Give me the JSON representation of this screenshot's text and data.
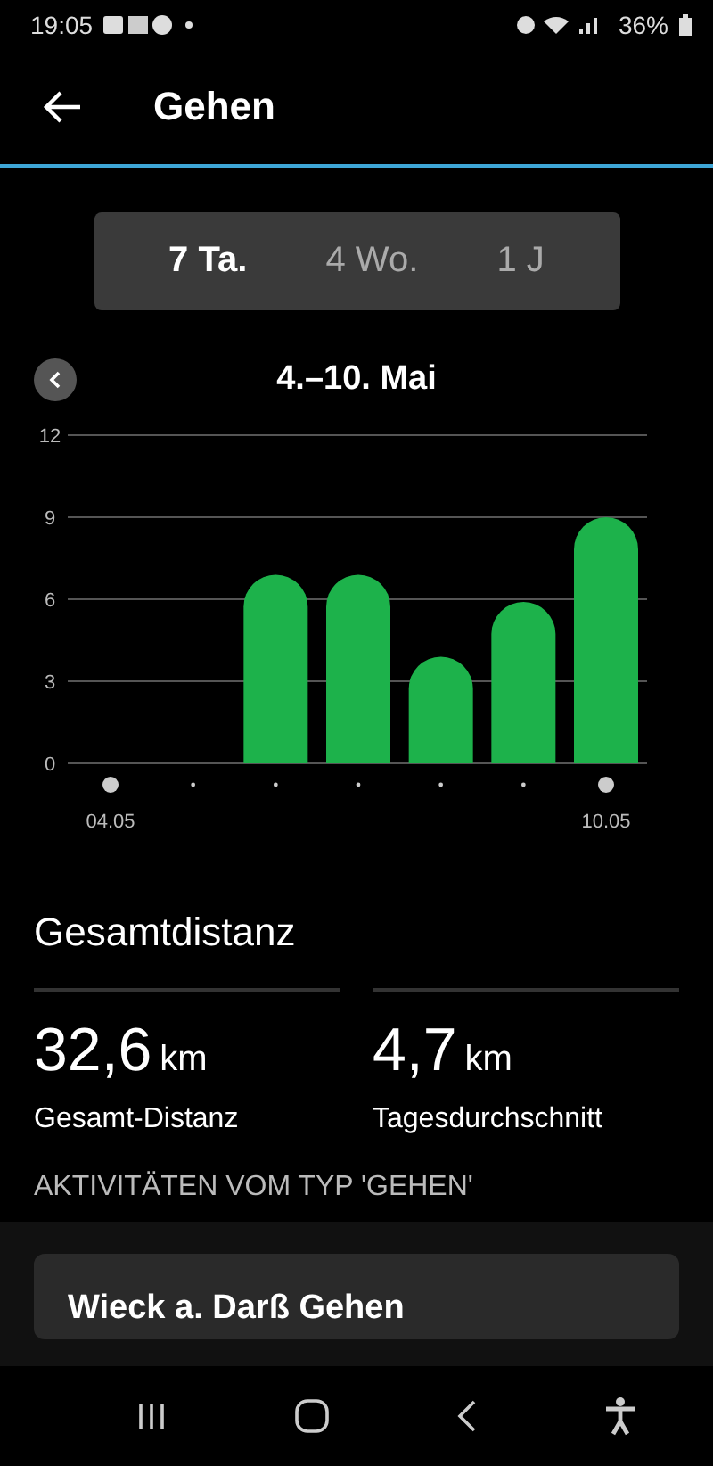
{
  "status_bar": {
    "time": "19:05",
    "battery": "36%"
  },
  "header": {
    "title": "Gehen"
  },
  "range_tabs": [
    {
      "label": "7 Ta.",
      "selected": true
    },
    {
      "label": "4 Wo.",
      "selected": false
    },
    {
      "label": "1 J",
      "selected": false
    }
  ],
  "period": {
    "label": "4.–10. Mai"
  },
  "chart": {
    "chart_data": {
      "type": "bar",
      "categories": [
        "04.05",
        null,
        null,
        null,
        null,
        null,
        "10.05"
      ],
      "series": [
        {
          "color": "#1db24b",
          "values": [
            null,
            null,
            6.9,
            6.9,
            3.9,
            5.9,
            9.0
          ]
        }
      ],
      "ylim": [
        0,
        12
      ],
      "yticks": [
        0,
        3,
        6,
        9,
        12
      ],
      "grid": true
    }
  },
  "summary": {
    "title": "Gesamtdistanz",
    "stats": [
      {
        "value": "32,6",
        "unit": "km",
        "label": "Gesamt-Distanz"
      },
      {
        "value": "4,7",
        "unit": "km",
        "label": "Tagesdurchschnitt"
      }
    ]
  },
  "activities": {
    "title": "AKTIVITÄTEN VOM TYP 'GEHEN'",
    "items": [
      {
        "title": "Wieck a. Darß Gehen"
      }
    ]
  }
}
